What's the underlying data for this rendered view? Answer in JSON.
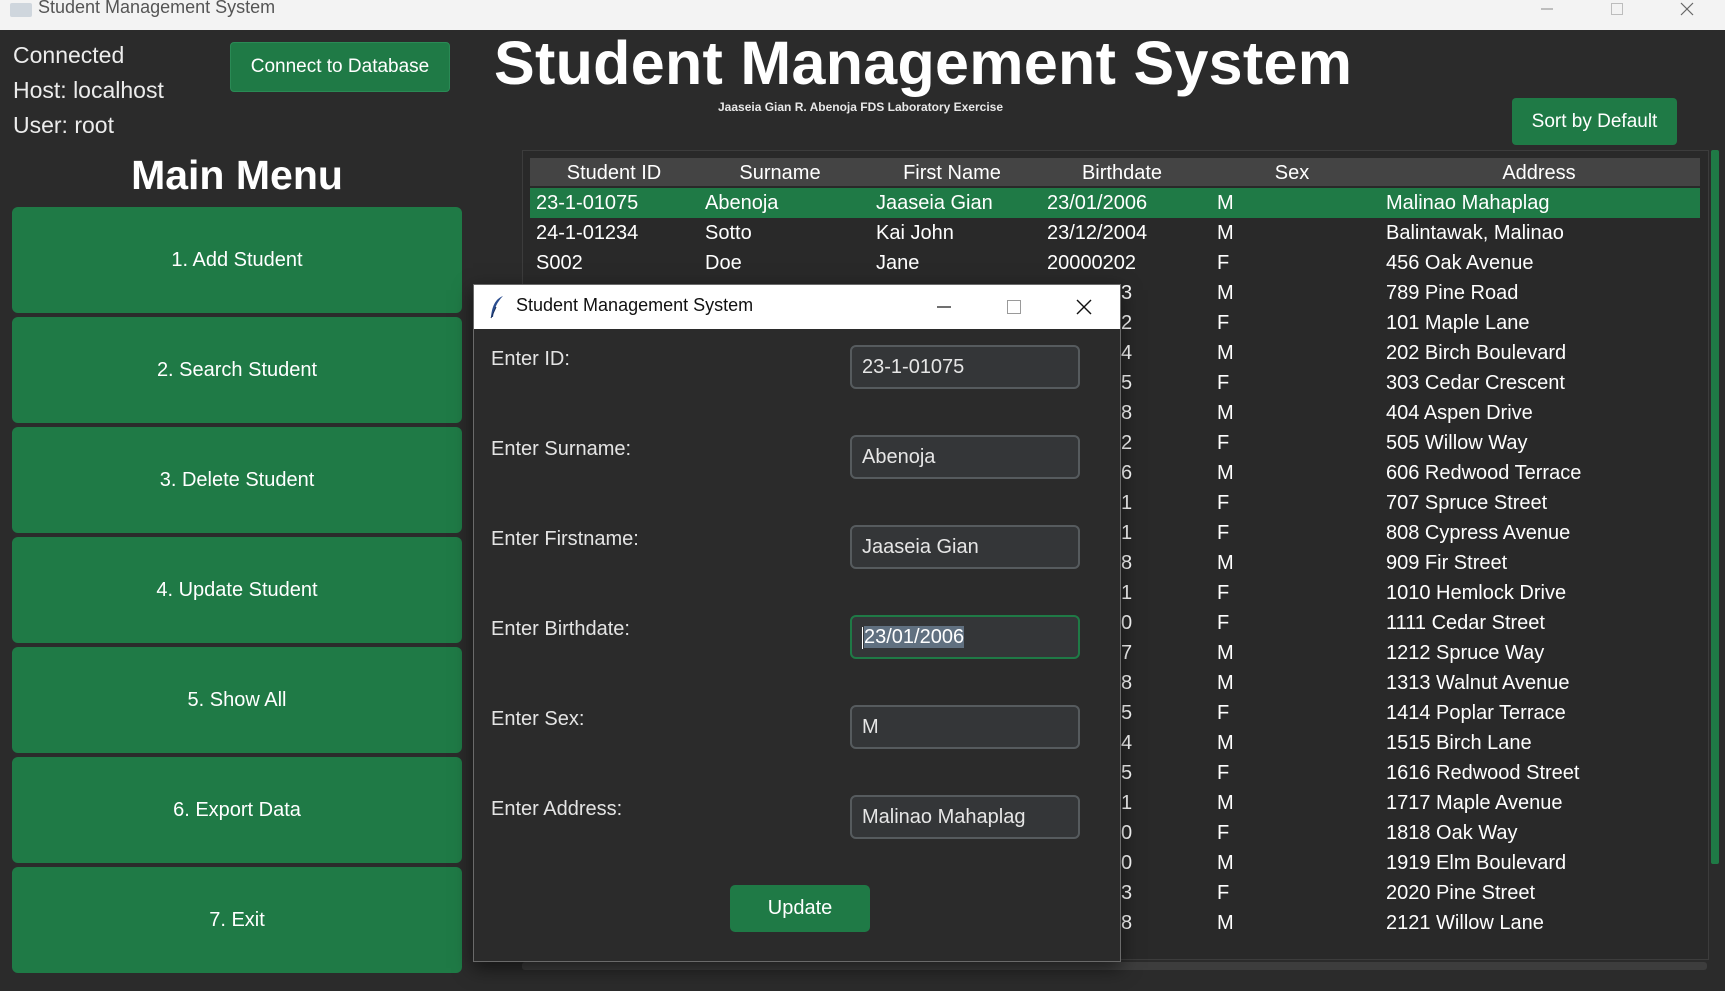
{
  "window": {
    "title": "Student Management System"
  },
  "status": {
    "connection": "Connected",
    "host": "Host: localhost",
    "user": "User: root"
  },
  "buttons": {
    "connect": "Connect to Database",
    "sort": "Sort by Default"
  },
  "header": {
    "title": "Student Management System",
    "subtitle": "Jaaseia Gian R. Abenoja FDS Laboratory Exercise"
  },
  "menu": {
    "title": "Main Menu",
    "items": [
      {
        "label": "1. Add Student"
      },
      {
        "label": "2. Search Student"
      },
      {
        "label": "3. Delete Student"
      },
      {
        "label": "4. Update Student"
      },
      {
        "label": "5. Show All"
      },
      {
        "label": "6. Export Data"
      },
      {
        "label": "7. Exit"
      }
    ]
  },
  "table": {
    "columns": [
      "Student ID",
      "Surname",
      "First Name",
      "Birthdate",
      "Sex",
      "Address"
    ],
    "rows": [
      {
        "id": "23-1-01075",
        "surname": "Abenoja",
        "first": "Jaaseia Gian",
        "birth": "23/01/2006",
        "sex": "M",
        "address": "Malinao Mahaplag",
        "selected": true
      },
      {
        "id": "24-1-01234",
        "surname": "Sotto",
        "first": "Kai John",
        "birth": "23/12/2004",
        "sex": "M",
        "address": "Balintawak, Malinao"
      },
      {
        "id": "S002",
        "surname": "Doe",
        "first": "Jane",
        "birth": "20000202",
        "sex": "F",
        "address": "456 Oak Avenue"
      },
      {
        "birth_tail": "3",
        "sex": "M",
        "address": "789 Pine Road"
      },
      {
        "birth_tail": "2",
        "sex": "F",
        "address": "101 Maple Lane"
      },
      {
        "birth_tail": "4",
        "sex": "M",
        "address": "202 Birch Boulevard"
      },
      {
        "birth_tail": "5",
        "sex": "F",
        "address": "303 Cedar Crescent"
      },
      {
        "birth_tail": "8",
        "sex": "M",
        "address": "404 Aspen Drive"
      },
      {
        "birth_tail": "2",
        "sex": "F",
        "address": "505 Willow Way"
      },
      {
        "birth_tail": "6",
        "sex": "M",
        "address": "606 Redwood Terrace"
      },
      {
        "birth_tail": "1",
        "sex": "F",
        "address": "707 Spruce Street"
      },
      {
        "birth_tail": "1",
        "sex": "F",
        "address": "808 Cypress Avenue"
      },
      {
        "birth_tail": "8",
        "sex": "M",
        "address": "909 Fir Street"
      },
      {
        "birth_tail": "1",
        "sex": "F",
        "address": "1010 Hemlock Drive"
      },
      {
        "birth_tail": "0",
        "sex": "F",
        "address": "1111 Cedar Street"
      },
      {
        "birth_tail": "7",
        "sex": "M",
        "address": "1212 Spruce Way"
      },
      {
        "birth_tail": "8",
        "sex": "M",
        "address": "1313 Walnut Avenue"
      },
      {
        "birth_tail": "5",
        "sex": "F",
        "address": "1414 Poplar Terrace"
      },
      {
        "birth_tail": "4",
        "sex": "M",
        "address": "1515 Birch Lane"
      },
      {
        "birth_tail": "5",
        "sex": "F",
        "address": "1616 Redwood Street"
      },
      {
        "birth_tail": "1",
        "sex": "M",
        "address": "1717 Maple Avenue"
      },
      {
        "birth_tail": "0",
        "sex": "F",
        "address": "1818 Oak Way"
      },
      {
        "birth_tail": "0",
        "sex": "M",
        "address": "1919 Elm Boulevard"
      },
      {
        "birth_tail": "3",
        "sex": "F",
        "address": "2020 Pine Street"
      },
      {
        "birth_tail": "8",
        "sex": "M",
        "address": "2121 Willow Lane"
      }
    ]
  },
  "dialog": {
    "title": "Student Management System",
    "fields": [
      {
        "label": "Enter ID:",
        "value": "23-1-01075"
      },
      {
        "label": "Enter Surname:",
        "value": "Abenoja"
      },
      {
        "label": "Enter Firstname:",
        "value": "Jaaseia Gian"
      },
      {
        "label": "Enter Birthdate:",
        "value": "23/01/2006",
        "focused": true
      },
      {
        "label": "Enter Sex:",
        "value": "M"
      },
      {
        "label": "Enter Address:",
        "value": "Malinao Mahaplag"
      }
    ],
    "update_label": "Update"
  },
  "colors": {
    "accent": "#1f7a46",
    "background": "#2b2b2b",
    "header_row": "#444444"
  },
  "icons": {
    "app": "app-icon",
    "dialog": "feather-icon",
    "minimize": "minimize-icon",
    "maximize": "maximize-icon",
    "close": "close-icon"
  }
}
